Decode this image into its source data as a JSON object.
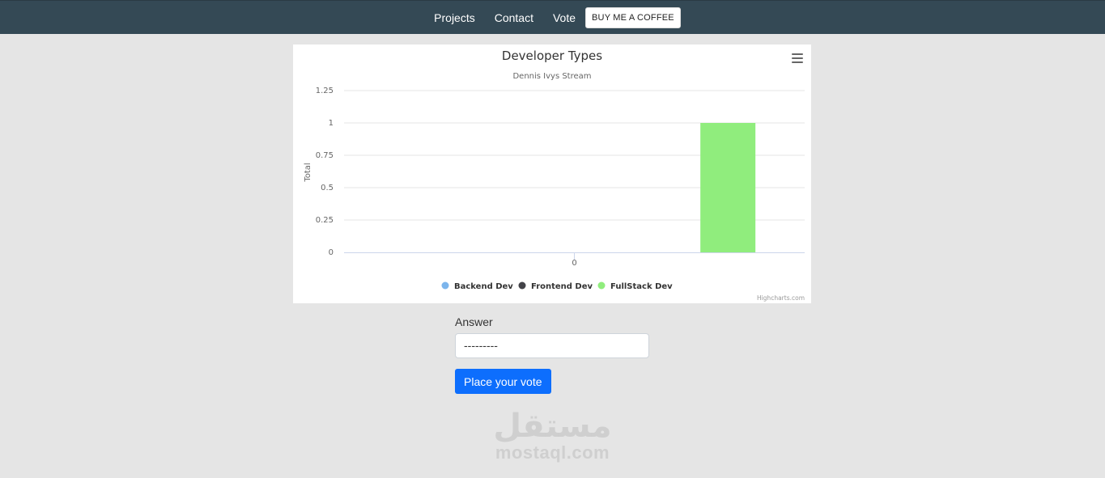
{
  "nav": {
    "links": [
      "Projects",
      "Contact",
      "Vote"
    ],
    "coffee_label": "BUY ME A COFFEE"
  },
  "colors": {
    "navbar": "#344955",
    "backend": "#7cb5ec",
    "frontend": "#434348",
    "fullstack": "#90ed7d",
    "button": "#0d6efd"
  },
  "chart_data": {
    "type": "bar",
    "title": "Developer Types",
    "subtitle": "Dennis Ivys Stream",
    "xlabel": "",
    "ylabel": "Total",
    "categories": [
      "0"
    ],
    "series": [
      {
        "name": "Backend Dev",
        "values": [
          0
        ]
      },
      {
        "name": "Frontend Dev",
        "values": [
          0
        ]
      },
      {
        "name": "FullStack Dev",
        "values": [
          1
        ]
      }
    ],
    "ylim": [
      0,
      1.25
    ],
    "yticks": [
      "0",
      "0.25",
      "0.5",
      "0.75",
      "1",
      "1.25"
    ],
    "grid": true,
    "legend": "bottom-center",
    "credits": "Highcharts.com",
    "menu_icon": "hamburger-icon"
  },
  "form": {
    "label": "Answer",
    "selected": "---------",
    "submit_label": "Place your vote"
  },
  "watermark": {
    "arabic": "مستقل",
    "latin": "mostaql.com"
  }
}
